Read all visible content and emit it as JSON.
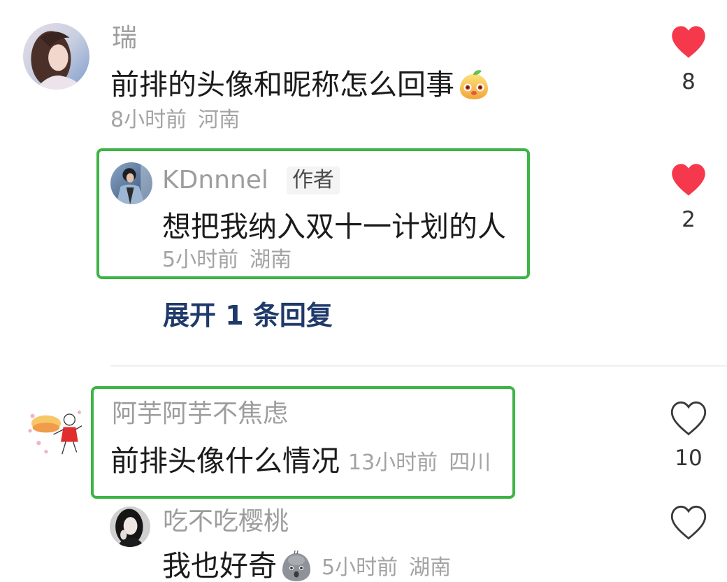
{
  "colors": {
    "like_red": "#f5384c",
    "highlight_green": "#3db445",
    "link_blue": "#1f3a6a",
    "username_gray": "#9d9d9d",
    "meta_gray": "#a3a3a3"
  },
  "icons": {
    "liked": "heart-filled-icon",
    "not_liked": "heart-outline-icon"
  },
  "comments": [
    {
      "username": "瑞",
      "text": "前排的头像和昵称怎么回事",
      "emoji": "mango-face-emoji-icon",
      "time": "8小时前",
      "location": "河南",
      "likes": "8",
      "liked": true,
      "replies": [
        {
          "username": "KDnnnel",
          "badge": "作者",
          "text": "想把我纳入双十一计划的人",
          "time": "5小时前",
          "location": "湖南",
          "likes": "2",
          "liked": true,
          "highlighted": true
        }
      ],
      "expand_label": "展开 1 条回复"
    },
    {
      "username": "阿芋阿芋不焦虑",
      "text": "前排头像什么情况",
      "time": "13小时前",
      "location": "四川",
      "likes": "10",
      "liked": false,
      "highlighted": true,
      "replies": [
        {
          "username": "吃不吃樱桃",
          "text": "我也好奇",
          "emoji": "gray-face-emoji-icon",
          "time": "5小时前",
          "location": "湖南",
          "liked": false
        }
      ]
    }
  ]
}
